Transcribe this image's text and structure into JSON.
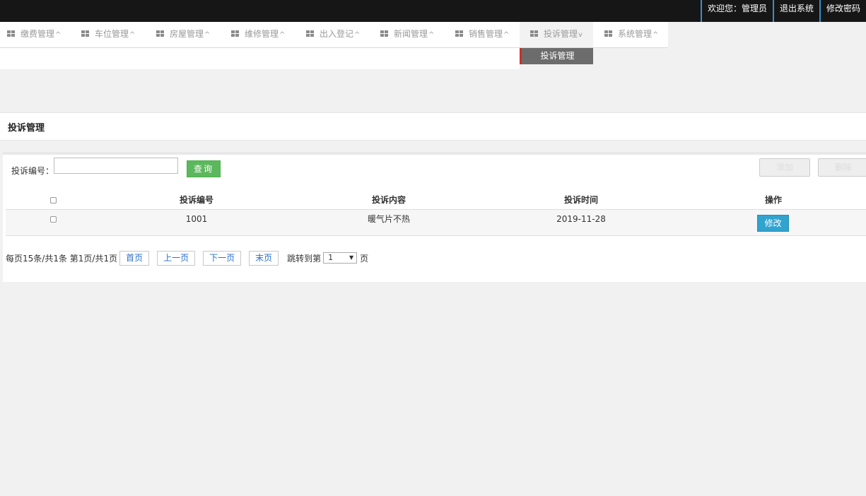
{
  "header": {
    "welcome": "欢迎您：管理员",
    "logout": "退出系统",
    "change_password": "修改密码"
  },
  "nav": {
    "items": [
      {
        "label": "缴费管理",
        "caret": "^"
      },
      {
        "label": "车位管理",
        "caret": "^"
      },
      {
        "label": "房屋管理",
        "caret": "^"
      },
      {
        "label": "维修管理",
        "caret": "^"
      },
      {
        "label": "出入登记",
        "caret": "^"
      },
      {
        "label": "新闻管理",
        "caret": "^"
      },
      {
        "label": "销售管理",
        "caret": "^"
      },
      {
        "label": "投诉管理",
        "caret": "v"
      },
      {
        "label": "系统管理",
        "caret": "^"
      }
    ],
    "active_index": 7,
    "submenu_item": "投诉管理"
  },
  "page": {
    "title": "投诉管理"
  },
  "search": {
    "label": "投诉编号：",
    "value": "",
    "query_button": "查询",
    "add_button": "添加",
    "delete_button": "删除"
  },
  "table": {
    "columns": [
      "投诉编号",
      "投诉内容",
      "投诉时间",
      "操作"
    ],
    "rows": [
      {
        "id": "1001",
        "content": "暖气片不热",
        "time": "2019-11-28",
        "action": "修改"
      }
    ]
  },
  "pager": {
    "summary": "每页15条/共1条 第1页/共1页",
    "first": "首页",
    "prev": "上一页",
    "next": "下一页",
    "last": "末页",
    "jump_label": "跳转到第",
    "jump_value": "1",
    "jump_suffix": "页"
  }
}
